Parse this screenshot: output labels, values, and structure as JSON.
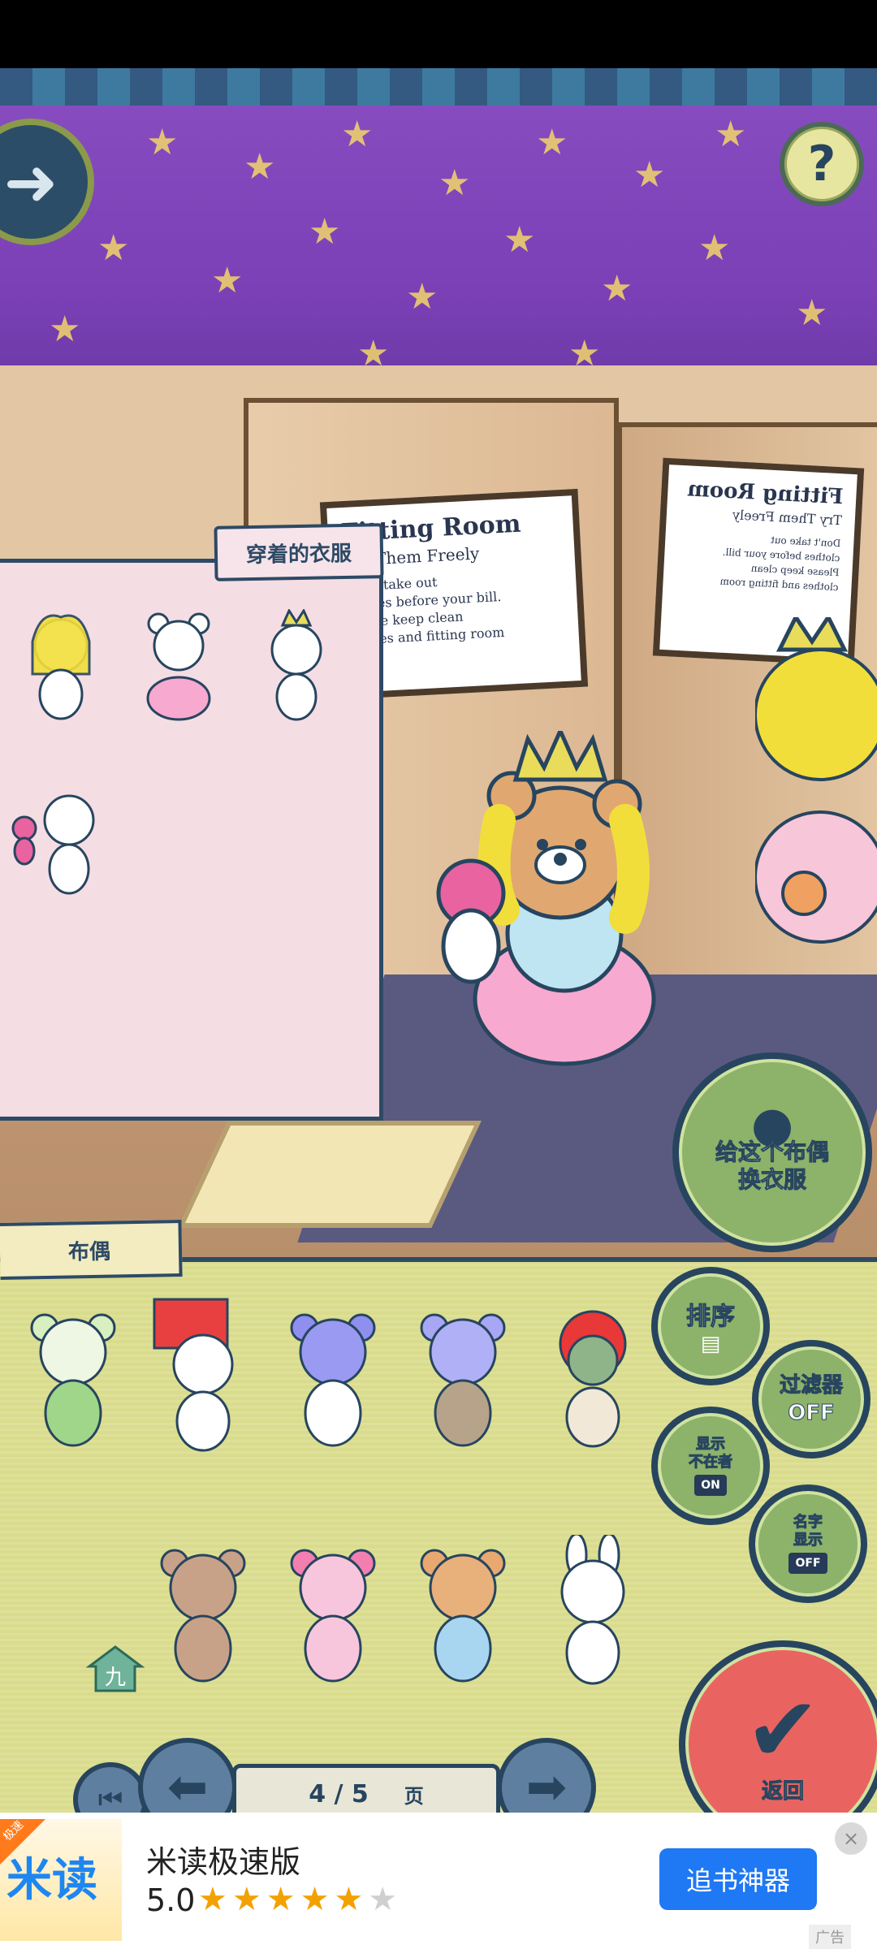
{
  "game": {
    "help_label": "?",
    "wearing_panel": {
      "title": "穿着的衣服"
    },
    "change_button": {
      "label_line1": "给这个布偶",
      "label_line2": "换衣服"
    },
    "doll_panel": {
      "title": "布偶"
    },
    "sort_button": {
      "label": "排序"
    },
    "filter_button": {
      "label_line1": "过滤器",
      "label_line2": "OFF"
    },
    "absent_button": {
      "label_line1": "显示",
      "label_line2": "不在者",
      "toggle": "ON"
    },
    "name_button": {
      "label_line1": "名字",
      "label_line2": "显示",
      "toggle": "OFF"
    },
    "return_button": {
      "label": "返回"
    },
    "home_marker": {
      "label": "九"
    },
    "pager": {
      "page": "4 / 5",
      "unit": "页"
    },
    "signs": {
      "main": {
        "title": "Fitting Room",
        "subtitle": "Try Them Freely",
        "line1": "Don't take out",
        "line2": "clothes before your bill.",
        "line3": "Please keep clean",
        "line4": "clothes and fitting room"
      },
      "mirror": {
        "title": "Fitting Room",
        "subtitle": "Try Them Freely",
        "line1": "Don't take out",
        "line2": "clothes before your bill.",
        "line3": "Please keep clean",
        "line4": "clothes and fitting room"
      }
    }
  },
  "ad": {
    "logo_text": "米读",
    "logo_tag": "极速",
    "title": "米读极速版",
    "rating": "5.0",
    "stars_on": "★★★★★",
    "stars_off": "★",
    "cta": "追书神器",
    "close": "×",
    "ad_label": "广告"
  },
  "colors": {
    "wall": "#7b3fb6",
    "panel_border": "#2d4a66",
    "doll_panel": "#d9dc8c",
    "button_green": "#8db26a",
    "return_red": "#e96460",
    "ad_blue": "#1f78f4"
  }
}
